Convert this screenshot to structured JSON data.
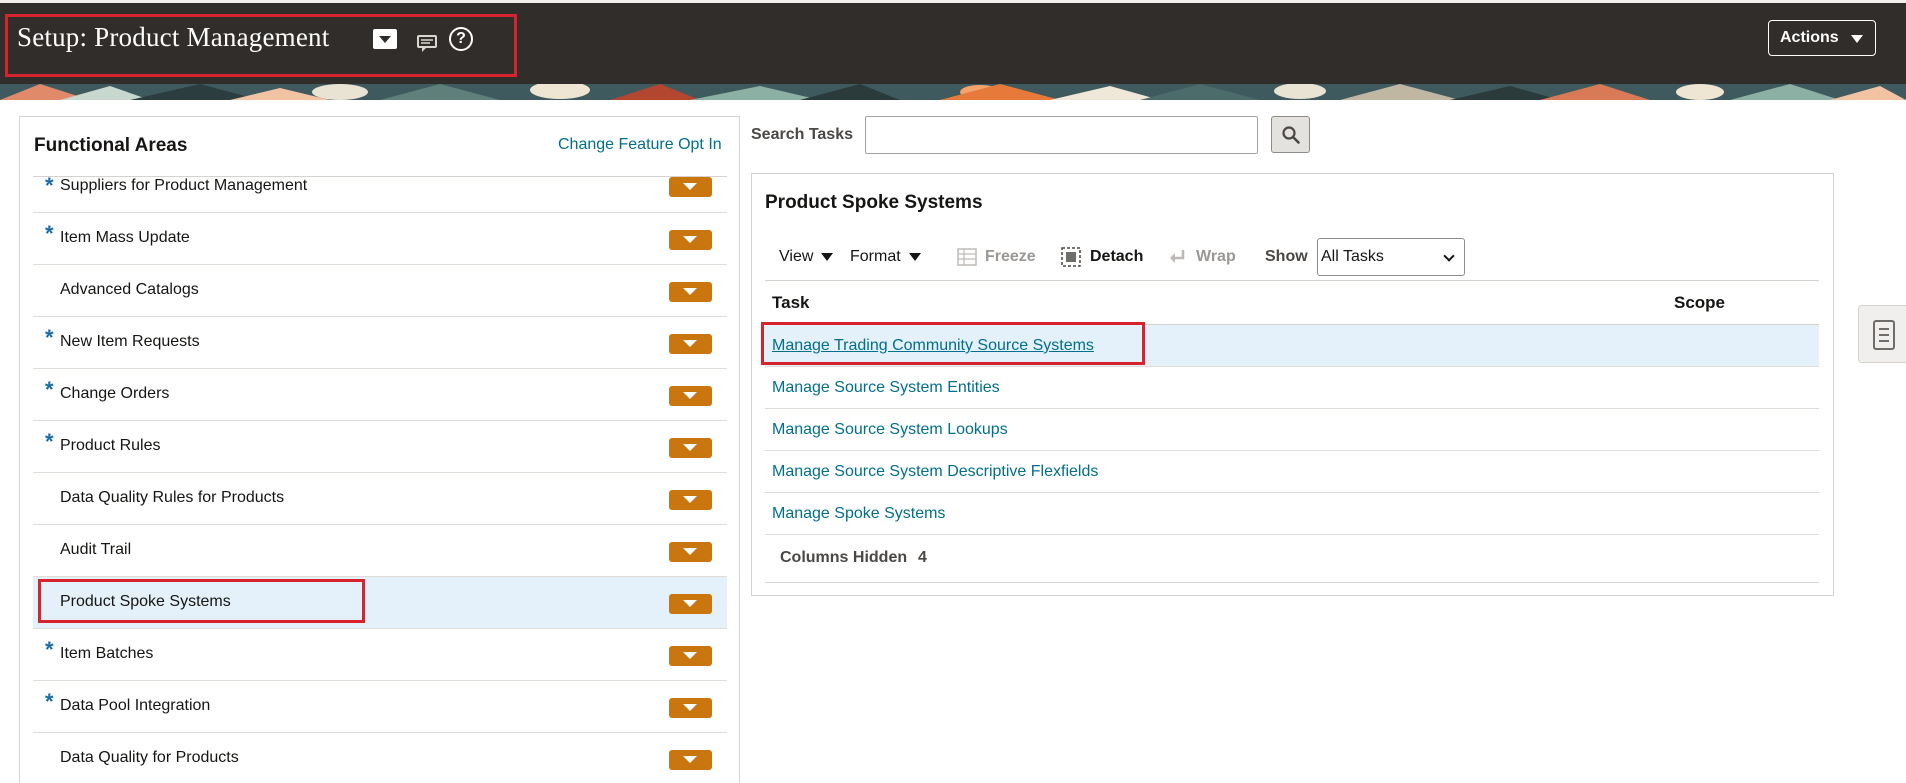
{
  "header": {
    "title": "Setup: Product Management",
    "actions_label": "Actions",
    "icons": [
      "page-dropdown-icon",
      "chat-icon",
      "help-icon"
    ]
  },
  "functional_areas": {
    "title": "Functional Areas",
    "change_link": "Change Feature Opt In",
    "items": [
      {
        "label": "Suppliers for Product Management",
        "required": "*"
      },
      {
        "label": "Item Mass Update",
        "required": "*"
      },
      {
        "label": "Advanced Catalogs",
        "required": ""
      },
      {
        "label": "New Item Requests",
        "required": "*"
      },
      {
        "label": "Change Orders",
        "required": "*"
      },
      {
        "label": "Product Rules",
        "required": "*"
      },
      {
        "label": "Data Quality Rules for Products",
        "required": ""
      },
      {
        "label": "Audit Trail",
        "required": ""
      },
      {
        "label": "Product Spoke Systems",
        "required": ""
      },
      {
        "label": "Item Batches",
        "required": "*"
      },
      {
        "label": "Data Pool Integration",
        "required": "*"
      },
      {
        "label": "Data Quality for Products",
        "required": ""
      }
    ]
  },
  "search": {
    "label": "Search Tasks",
    "placeholder": ""
  },
  "tasks_panel": {
    "title": "Product Spoke Systems",
    "toolbar": {
      "view": "View",
      "format": "Format",
      "freeze": "Freeze",
      "detach": "Detach",
      "wrap": "Wrap",
      "show_label": "Show",
      "show_value": "All Tasks"
    },
    "columns": {
      "task": "Task",
      "scope": "Scope"
    },
    "rows": [
      "Manage Trading Community Source Systems",
      "Manage Source System Entities",
      "Manage Source System Lookups",
      "Manage Source System Descriptive Flexfields",
      "Manage Spoke Systems"
    ],
    "columns_hidden_label": "Columns Hidden",
    "columns_hidden_count": "4"
  },
  "colors": {
    "header_bg": "#312d2a",
    "link": "#026f8c",
    "accent_orange": "#c9760e",
    "selected_row": "#e4f1fa",
    "highlight_red": "#d6232d"
  }
}
